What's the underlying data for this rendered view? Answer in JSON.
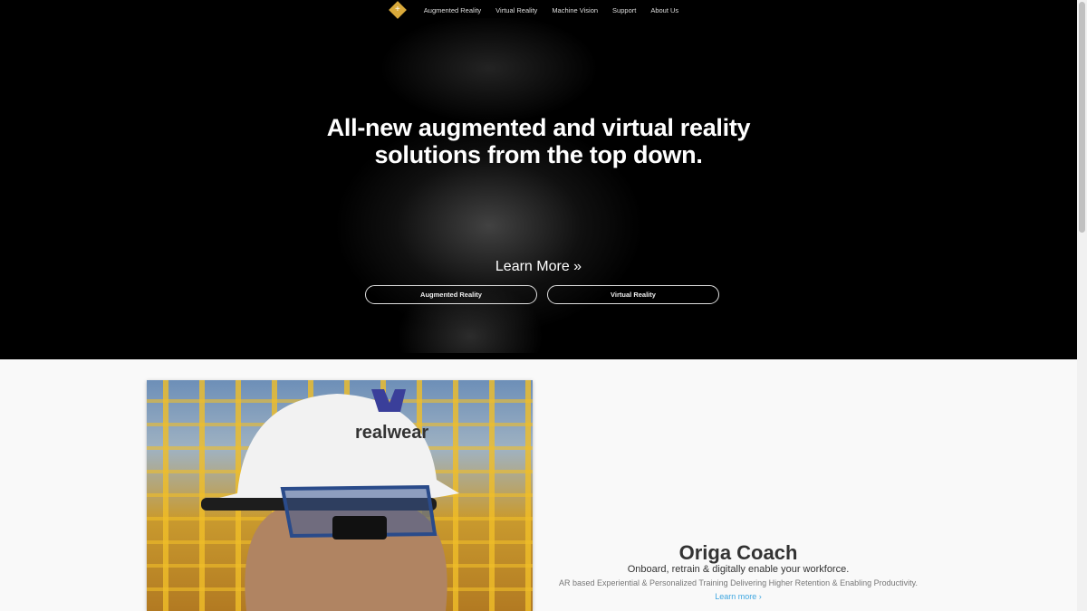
{
  "nav": {
    "logo": "+",
    "items": [
      "Augmented Reality",
      "Virtual Reality",
      "Machine Vision",
      "Support",
      "About Us"
    ]
  },
  "hero": {
    "headline_1": "All-new augmented and virtual reality",
    "headline_2": "solutions from the top down.",
    "learn_more": "Learn More »",
    "buttons": [
      "Augmented Reality",
      "Virtual Reality"
    ]
  },
  "feature": {
    "helmet_logo": "realwear",
    "title": "Origa Coach",
    "subtitle": "Onboard, retrain & digitally enable your workforce.",
    "description": "AR based Experiential & Personalized Training Delivering Higher Retention & Enabling Productivity.",
    "link": "Learn more  ›"
  },
  "colors": {
    "accent": "#3ea6e0",
    "logo": "#d9a93a"
  }
}
